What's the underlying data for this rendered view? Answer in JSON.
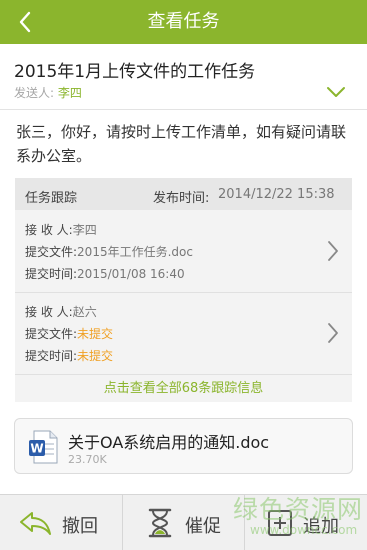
{
  "header": {
    "title": "查看任务",
    "back_icon": "chevron-left-icon"
  },
  "task": {
    "subject": "2015年1月上传文件的工作任务",
    "sender_label": "发送人:",
    "sender_name": "李四",
    "message": "张三，你好，请按时上传工作清单，如有疑问请联系办公室。"
  },
  "tracking": {
    "title": "任务跟踪",
    "publish_label": "发布时间:",
    "publish_time": "2014/12/22 15:38",
    "entries": [
      {
        "receiver_label": "接 收 人:",
        "receiver": "李四",
        "file_label": "提交文件:",
        "file": "2015年工作任务.doc",
        "time_label": "提交时间:",
        "time": "2015/01/08 16:40"
      },
      {
        "receiver_label": "接 收 人:",
        "receiver": "赵六",
        "file_label": "提交文件:",
        "file": "未提交",
        "time_label": "提交时间:",
        "time": "未提交"
      }
    ],
    "view_all": "点击查看全部68条跟踪信息"
  },
  "attachment": {
    "name": "关于OA系统启用的通知.doc",
    "size": "23.70K",
    "icon": "word-doc-icon"
  },
  "bottom_bar": [
    {
      "label": "撤回",
      "icon": "undo-arrow-icon"
    },
    {
      "label": "催促",
      "icon": "hourglass-icon"
    },
    {
      "label": "追加",
      "icon": "add-icon"
    }
  ],
  "watermark": {
    "line1": "绿色资源网",
    "line2": "www.downcc.com"
  },
  "colors": {
    "brand": "#8bb52d",
    "warning": "#f0a024",
    "muted": "#a7a7a7"
  }
}
